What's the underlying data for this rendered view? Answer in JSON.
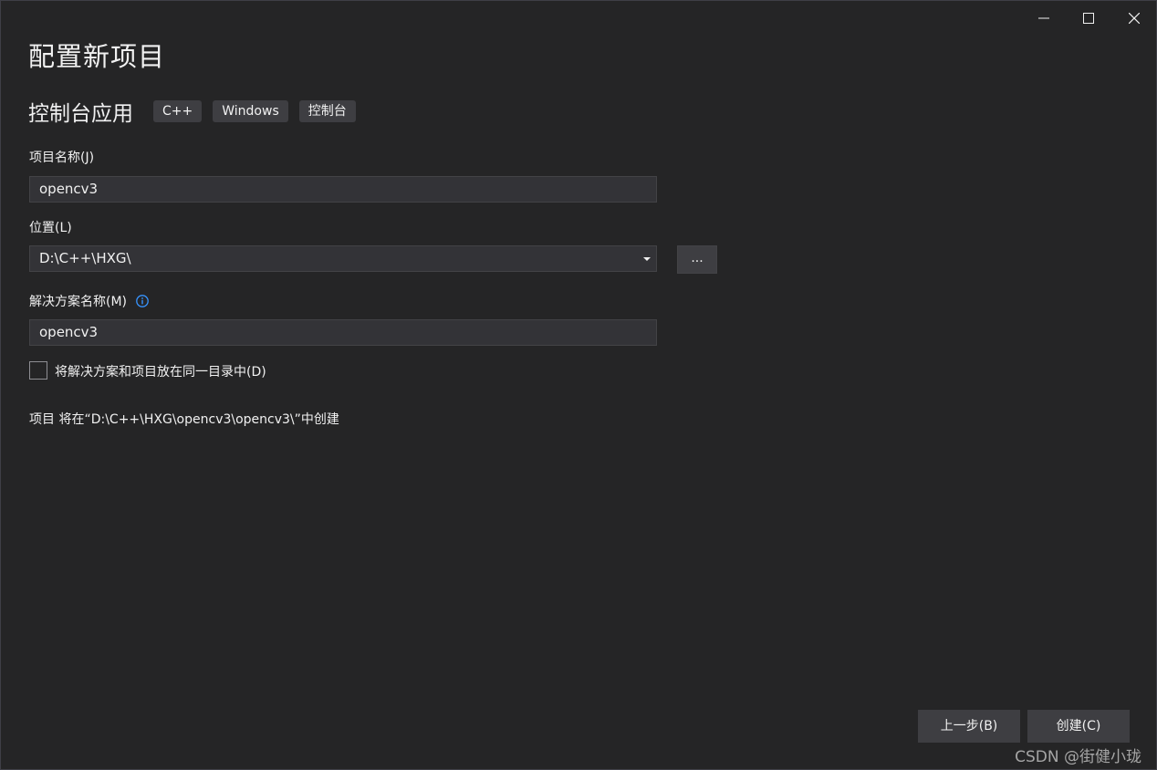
{
  "window": {
    "controls": {
      "minimize_icon": "minimize-icon",
      "maximize_icon": "maximize-icon",
      "close_icon": "close-icon"
    }
  },
  "header": {
    "title": "配置新项目",
    "template_name": "控制台应用",
    "tags": [
      "C++",
      "Windows",
      "控制台"
    ]
  },
  "form": {
    "project_name_label": "项目名称(J)",
    "project_name_value": "opencv3",
    "location_label": "位置(L)",
    "location_value": "D:\\C++\\HXG\\",
    "browse_label": "...",
    "solution_name_label": "解决方案名称(M)",
    "solution_name_value": "opencv3",
    "same_dir_label": "将解决方案和项目放在同一目录中(D)",
    "same_dir_checked": false,
    "path_info": "项目 将在“D:\\C++\\HXG\\opencv3\\opencv3\\”中创建"
  },
  "footer": {
    "back_label": "上一步(B)",
    "create_label": "创建(C)"
  },
  "watermark": "CSDN @街健小珑",
  "colors": {
    "background": "#252526",
    "input_bg": "#333337",
    "button_bg": "#3e3e42",
    "info_icon": "#3794ff"
  }
}
